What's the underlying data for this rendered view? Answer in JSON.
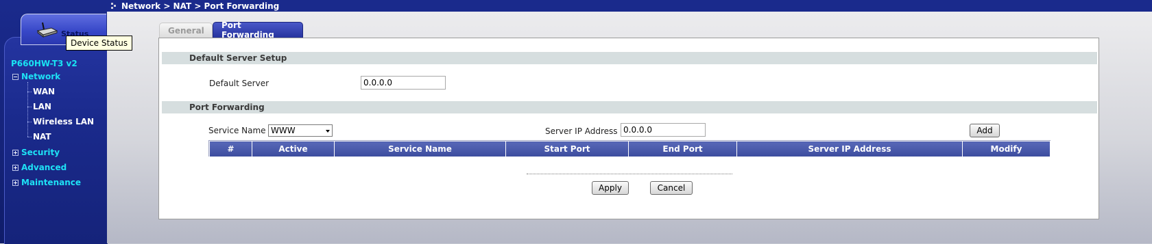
{
  "breadcrumb": "Network > NAT > Port Forwarding",
  "status_tab": {
    "label": "Status",
    "tooltip": "Device Status"
  },
  "device_model": "P660HW-T3 v2",
  "nav": {
    "network": "Network",
    "network_items": [
      "WAN",
      "LAN",
      "Wireless LAN",
      "NAT"
    ],
    "security": "Security",
    "advanced": "Advanced",
    "maintenance": "Maintenance"
  },
  "tabs": {
    "general": "General",
    "port_forwarding": "Port Forwarding"
  },
  "default_server_section": {
    "header": "Default Server Setup",
    "label": "Default Server",
    "value": "0.0.0.0"
  },
  "port_forwarding_section": {
    "header": "Port Forwarding",
    "service_name_label": "Service Name",
    "service_name_value": "WWW",
    "server_ip_label": "Server IP Address",
    "server_ip_value": "0.0.0.0",
    "add_label": "Add"
  },
  "table": {
    "columns": [
      "#",
      "Active",
      "Service Name",
      "Start Port",
      "End Port",
      "Server IP Address",
      "Modify"
    ]
  },
  "buttons": {
    "apply": "Apply",
    "cancel": "Cancel"
  },
  "colors": {
    "nav_bg": "#1a2a8c",
    "nav_link": "#1ee1f5",
    "header_blue": "#3c4c9e"
  }
}
